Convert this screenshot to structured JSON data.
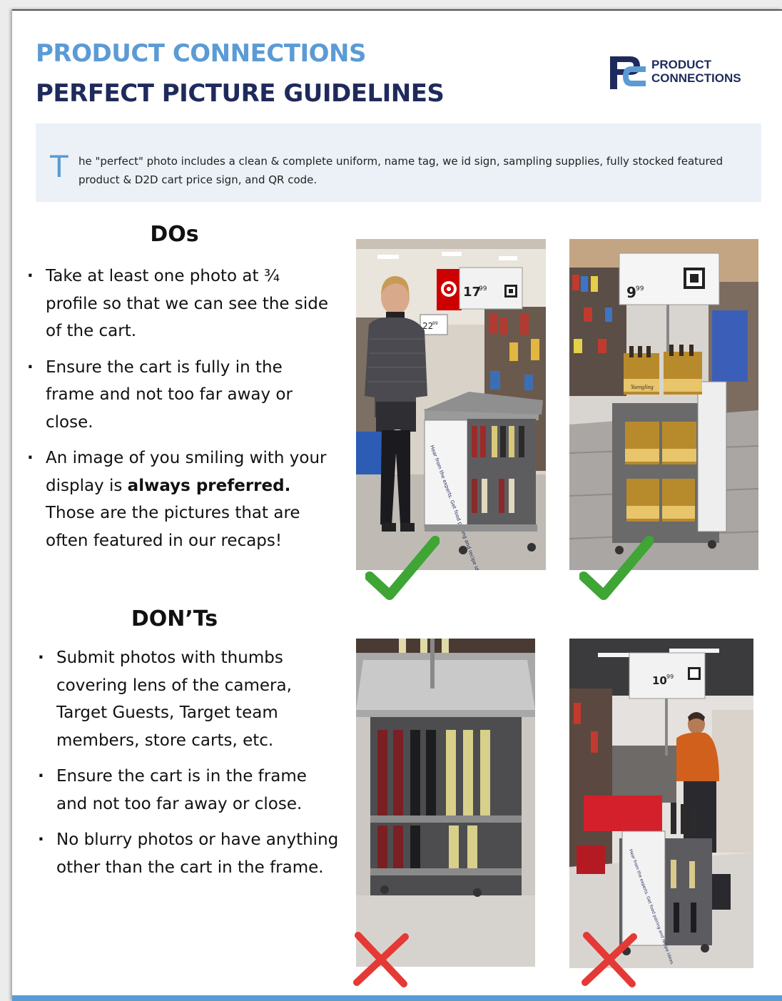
{
  "header": {
    "title_line1": "PRODUCT CONNECTIONS",
    "title_line2": "PERFECT PICTURE GUIDELINES"
  },
  "logo": {
    "line1": "PRODUCT",
    "line2": "CONNECTIONS",
    "monogram": "PC"
  },
  "intro": {
    "dropcap": "T",
    "text": "he \"perfect\" photo includes a clean & complete uniform, name tag, we id sign, sampling supplies, fully stocked featured product & D2D cart price sign, and QR code."
  },
  "dos": {
    "heading": "DOs",
    "items": [
      {
        "text": "Take at least one photo at ¾ profile so that we can see the side of the cart."
      },
      {
        "text": "Ensure the cart is fully in the frame and not too far away or close."
      },
      {
        "text_before": "An image of you smiling with your display is ",
        "bold": "always preferred.",
        "text_after": " Those are the pictures that are often featured in our recaps!"
      }
    ]
  },
  "donts": {
    "heading": "DON’Ts",
    "items": [
      {
        "text": "Submit photos with  thumbs covering lens of the camera, Target Guests, Target team members, store carts, etc."
      },
      {
        "text": "Ensure the cart is in the frame and not too far away or close."
      },
      {
        "text": "No blurry photos or have anything other than the cart in the frame."
      }
    ]
  },
  "photos": {
    "photo1": {
      "price_main": "17",
      "price_cents": "99",
      "side_price": "22",
      "side_cents": "99",
      "cart_sign": "Hear from the experts. Get food pairing and recipe ideas."
    },
    "photo2": {
      "price_main": "9",
      "price_cents": "99",
      "product_label": "Yuengling"
    },
    "photo4": {
      "price_main": "10",
      "price_cents": "99",
      "cart_sign": "Hear from the experts. Get food pairing and recipe ideas."
    }
  },
  "marks": {
    "check_color": "#3fa535",
    "x_color": "#e53935"
  },
  "colors": {
    "accent": "#5b9bd5",
    "navy": "#1f2a5c",
    "intro_bg": "#ebf1f7"
  }
}
